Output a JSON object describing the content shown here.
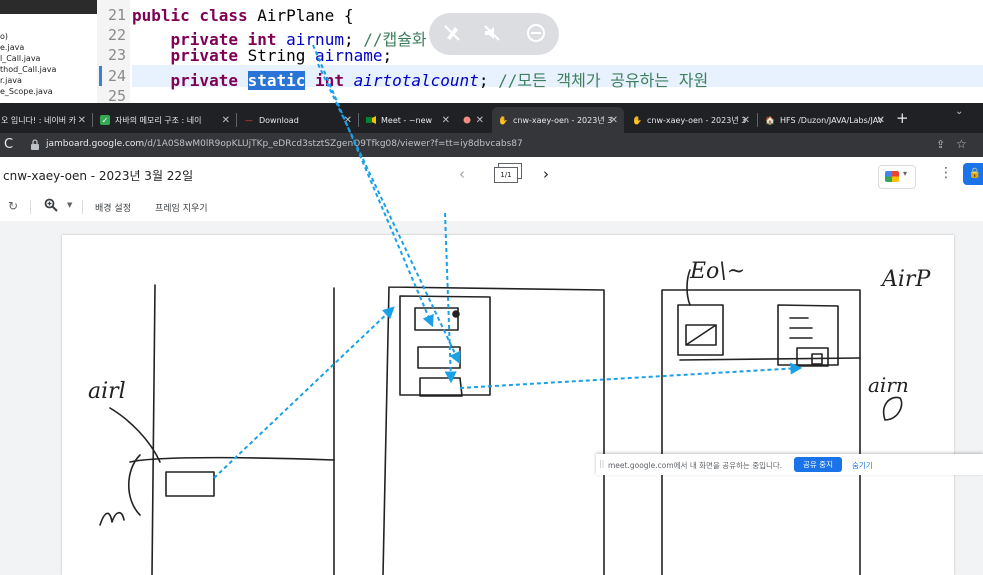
{
  "ide": {
    "file_items": [
      "o)",
      "e.java",
      "l_Call.java",
      "thod_Call.java",
      "r.java",
      "e_Scope.java"
    ],
    "line_numbers": [
      "21",
      "22",
      "23",
      "24",
      "25"
    ],
    "line21": {
      "kw": "public class",
      "name": " AirPlane {"
    },
    "line22": {
      "kw1": "private",
      "kw2": "int",
      "field": "airnum",
      "comment": "//캡슐화"
    },
    "line23": {
      "kw": "private",
      "type": "String",
      "field": "airname"
    },
    "line24": {
      "kw1": "private",
      "kw2": "static",
      "kw3": "int",
      "field": "airtotalcount",
      "comment": "//모든 객체가 공유하는 자원"
    }
  },
  "browser": {
    "tabs": [
      {
        "label": "오 입니다! : 네이버 카",
        "icon": "naver-icon",
        "active": false
      },
      {
        "label": "자바의 메모리 구조 : 네이",
        "icon": "bookmark-icon",
        "active": false
      },
      {
        "label": "Download",
        "icon": "download-icon",
        "active": false
      },
      {
        "label": "Meet - ~new",
        "icon": "meet-icon",
        "active": false
      },
      {
        "label": "",
        "icon": "record-icon",
        "active": false
      },
      {
        "label": "cnw-xaey-oen - 2023년 3",
        "icon": "jamboard-icon",
        "active": true
      },
      {
        "label": "cnw-xaey-oen - 2023년 3",
        "icon": "jamboard-icon",
        "active": false
      },
      {
        "label": "HFS /Duzon/JAVA/Labs/JAV",
        "icon": "hfs-icon",
        "active": false
      }
    ],
    "new_tab": "+",
    "url_host": "jamboard.google.com",
    "url_path": "/d/1A0S8wM0lR9opKLUjTKp_eDRcd3stztSZgenO9Tfkg08/viewer?f=tt=iy8dbvcabs87"
  },
  "jamboard": {
    "title": "cnw-xaey-oen - 2023년 3월 22일",
    "frame_indicator": "1/1",
    "bg_label": "배경 설정",
    "clear_label": "프레임 지우기"
  },
  "drawing": {
    "labels": [
      "airl",
      "Eo\\~",
      "AirP",
      "airn"
    ]
  },
  "share_bar": {
    "message": "meet.google.com에서 내 화면을 공유하는 중입니다.",
    "stop_label": "공유 중지",
    "hide_label": "숨기기"
  },
  "colors": {
    "arrow": "#1aa0e6",
    "ink": "#222222",
    "highlight": "#2a74d5",
    "keyword": "#7f0055"
  }
}
